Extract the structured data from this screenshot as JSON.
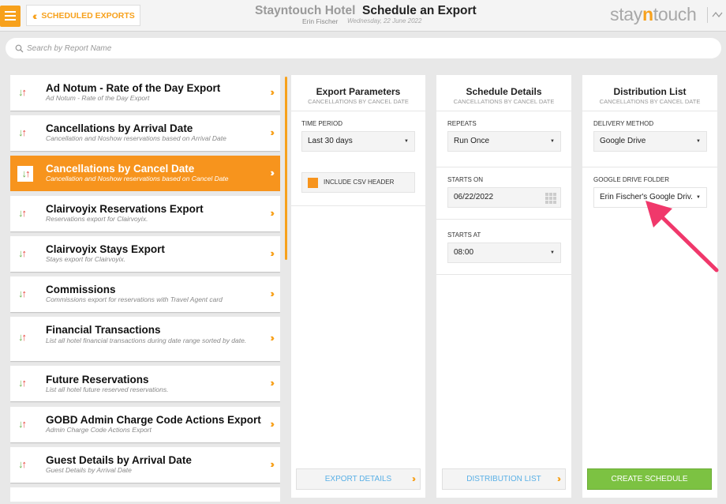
{
  "header": {
    "back_label": "SCHEDULED EXPORTS",
    "hotel": "Stayntouch Hotel",
    "title": "Schedule an Export",
    "user": "Erin Fischer",
    "date": "Wednesday, 22 June 2022",
    "logo_left": "stay",
    "logo_mid": "n",
    "logo_right": "touch"
  },
  "search": {
    "placeholder": "Search by Report Name"
  },
  "reports": [
    {
      "title": "Ad Notum - Rate of the Day Export",
      "desc": "Ad Notum - Rate of the Day Export"
    },
    {
      "title": "Cancellations by Arrival Date",
      "desc": "Cancellation and Noshow reservations based on Arrival Date"
    },
    {
      "title": "Cancellations by Cancel Date",
      "desc": "Cancellation and Noshow reservations based on Cancel Date",
      "active": true
    },
    {
      "title": "Clairvoyix Reservations Export",
      "desc": "Reservations export for Clairvoyix."
    },
    {
      "title": "Clairvoyix Stays Export",
      "desc": "Stays export for Clairvoyix."
    },
    {
      "title": "Commissions",
      "desc": "Commissions export for reservations with Travel Agent card"
    },
    {
      "title": "Financial Transactions",
      "desc": "List all hotel financial transactions during date range sorted by date."
    },
    {
      "title": "Future Reservations",
      "desc": "List all hotel future reserved reservations."
    },
    {
      "title": "GOBD Admin Charge Code Actions Export",
      "desc": "Admin Charge Code Actions Export"
    },
    {
      "title": "Guest Details by Arrival Date",
      "desc": "Guest Details by Arrival Date"
    }
  ],
  "export_params": {
    "title": "Export Parameters",
    "subtitle": "CANCELLATIONS BY CANCEL DATE",
    "time_period_label": "TIME PERIOD",
    "time_period_value": "Last 30 days",
    "csv_header_label": "INCLUDE CSV HEADER",
    "footer_button": "EXPORT DETAILS"
  },
  "schedule": {
    "title": "Schedule Details",
    "subtitle": "CANCELLATIONS BY CANCEL DATE",
    "repeats_label": "REPEATS",
    "repeats_value": "Run Once",
    "starts_on_label": "STARTS ON",
    "starts_on_value": "06/22/2022",
    "starts_at_label": "STARTS AT",
    "starts_at_value": "08:00",
    "footer_button": "DISTRIBUTION LIST"
  },
  "distribution": {
    "title": "Distribution List",
    "subtitle": "CANCELLATIONS BY CANCEL DATE",
    "delivery_label": "DELIVERY METHOD",
    "delivery_value": "Google Drive",
    "folder_label": "GOOGLE DRIVE FOLDER",
    "folder_value": "Erin Fischer's Google Driv.",
    "create_button": "CREATE SCHEDULE"
  },
  "colors": {
    "accent": "#f7941d",
    "create": "#7cc242",
    "link": "#5ab0e6",
    "pointer": "#f0386b"
  }
}
